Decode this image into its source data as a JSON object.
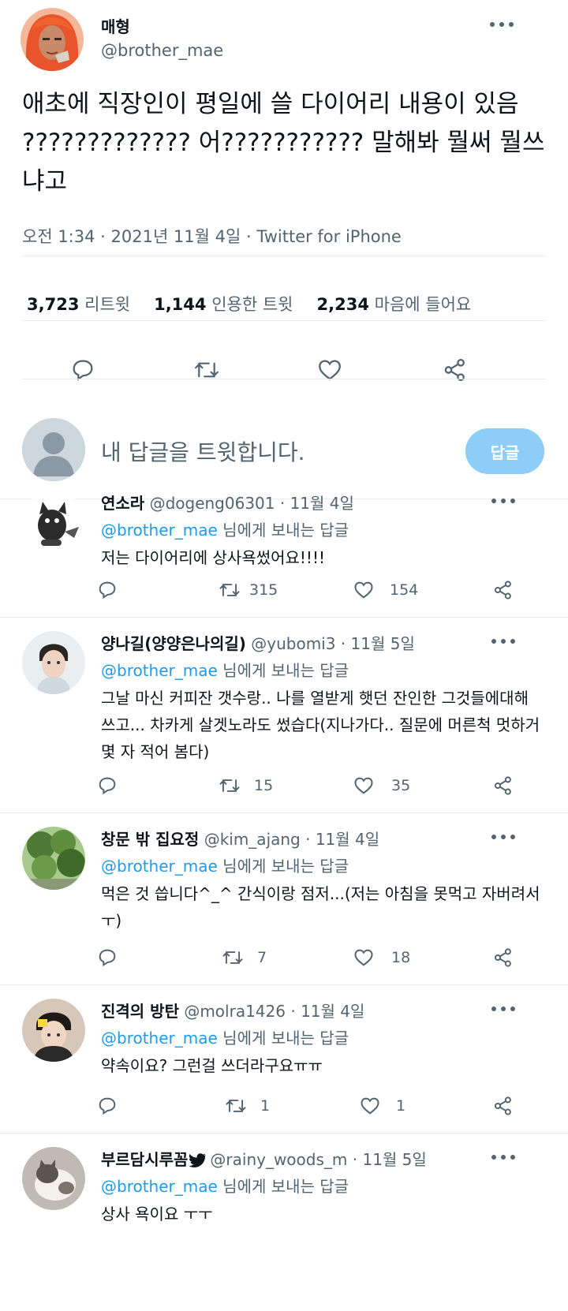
{
  "main": {
    "author_name": "매형",
    "author_handle": "@brother_mae",
    "text": "애초에 직장인이 평일에 쓸 다이어리 내용이 있음 ????????????? 어??????????? 말해봐 뭘써 뭘쓰냐고",
    "meta": "오전 1:34 · 2021년 11월 4일 · Twitter for iPhone",
    "stats": {
      "retweets_count": "3,723",
      "retweets_label": "리트윗",
      "quotes_count": "1,144",
      "quotes_label": "인용한 트윗",
      "likes_count": "2,234",
      "likes_label": "마음에 들어요"
    }
  },
  "composer": {
    "placeholder": "내 답글을 트윗합니다.",
    "button_label": "답글"
  },
  "replies": [
    {
      "name": "연소라",
      "handle": "@dogeng06301",
      "date": "11월 4일",
      "mention": "@brother_mae",
      "to_label": "님에게 보내는 답글",
      "text": "저는 다이어리에 상사욕썼어요!!!!",
      "retweets": "315",
      "likes": "154"
    },
    {
      "name": "양나길(양양은나의길)",
      "handle": "@yubomi3",
      "date": "11월 5일",
      "mention": "@brother_mae",
      "to_label": "님에게 보내는 답글",
      "text": "그날 마신 커피잔 갯수랑.. 나를 열받게 햇던 잔인한 그것들에대해 쓰고... 차카게 살겟노라도 썼습다(지나가다.. 질문에 머른척 멋하거 몇 자 적어 봄다)",
      "retweets": "15",
      "likes": "35"
    },
    {
      "name": "창문 밖 집요정",
      "handle": "@kim_ajang",
      "date": "11월 4일",
      "mention": "@brother_mae",
      "to_label": "님에게 보내는 답글",
      "text": "먹은 것 씁니다^_^ 간식이랑 점저...(저는 아침을 못먹고 자버려서ㅜ)",
      "retweets": "7",
      "likes": "18"
    },
    {
      "name": "진격의 방탄",
      "handle": "@molra1426",
      "date": "11월 4일",
      "mention": "@brother_mae",
      "to_label": "님에게 보내는 답글",
      "text": "약속이요? 그런걸 쓰더라구요ㅠㅠ",
      "retweets": "1",
      "likes": "1"
    },
    {
      "name": "부르담시루꼼",
      "handle": "@rainy_woods_m",
      "date": "11월 5일",
      "mention": "@brother_mae",
      "to_label": "님에게 보내는 답글",
      "text": "상사 욕이요 ㅜㅜ",
      "retweets": "",
      "likes": ""
    }
  ],
  "colors": {
    "accent": "#1d9bf0",
    "secondary_text": "#536471",
    "reply_button": "#8ecdf8"
  }
}
